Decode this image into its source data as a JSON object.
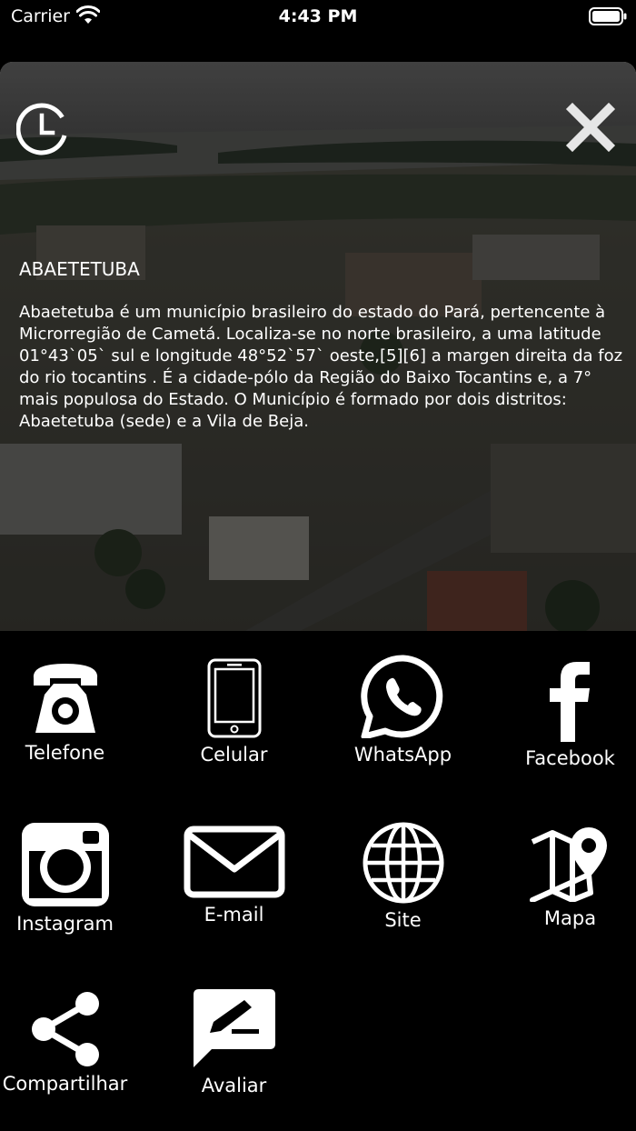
{
  "status_bar": {
    "carrier": "Carrier",
    "time": "4:43 PM"
  },
  "info": {
    "title": "ABAETETUBA",
    "description": "Abaetetuba é um município brasileiro do estado do Pará, pertencente à Microrregião de Cametá. Localiza-se no norte brasileiro, a uma latitude 01°43`05` sul e longitude 48°52`57` oeste,[5][6] a margen direita da foz do rio tocantins . É a cidade-pólo da Região do Baixo Tocantins e, a 7° mais populosa do Estado. O Município é formado por dois distritos: Abaetetuba (sede) e a Vila de Beja."
  },
  "actions": [
    {
      "label": "Telefone",
      "icon": "telephone-icon"
    },
    {
      "label": "Celular",
      "icon": "mobile-phone-icon"
    },
    {
      "label": "WhatsApp",
      "icon": "whatsapp-icon"
    },
    {
      "label": "Facebook",
      "icon": "facebook-icon"
    },
    {
      "label": "Instagram",
      "icon": "instagram-icon"
    },
    {
      "label": "E-mail",
      "icon": "email-icon"
    },
    {
      "label": "Site",
      "icon": "globe-icon"
    },
    {
      "label": "Mapa",
      "icon": "map-icon"
    },
    {
      "label": "Compartilhar",
      "icon": "share-icon"
    },
    {
      "label": "Avaliar",
      "icon": "rate-icon"
    }
  ],
  "colors": {
    "background": "#000000",
    "foreground": "#ffffff"
  }
}
